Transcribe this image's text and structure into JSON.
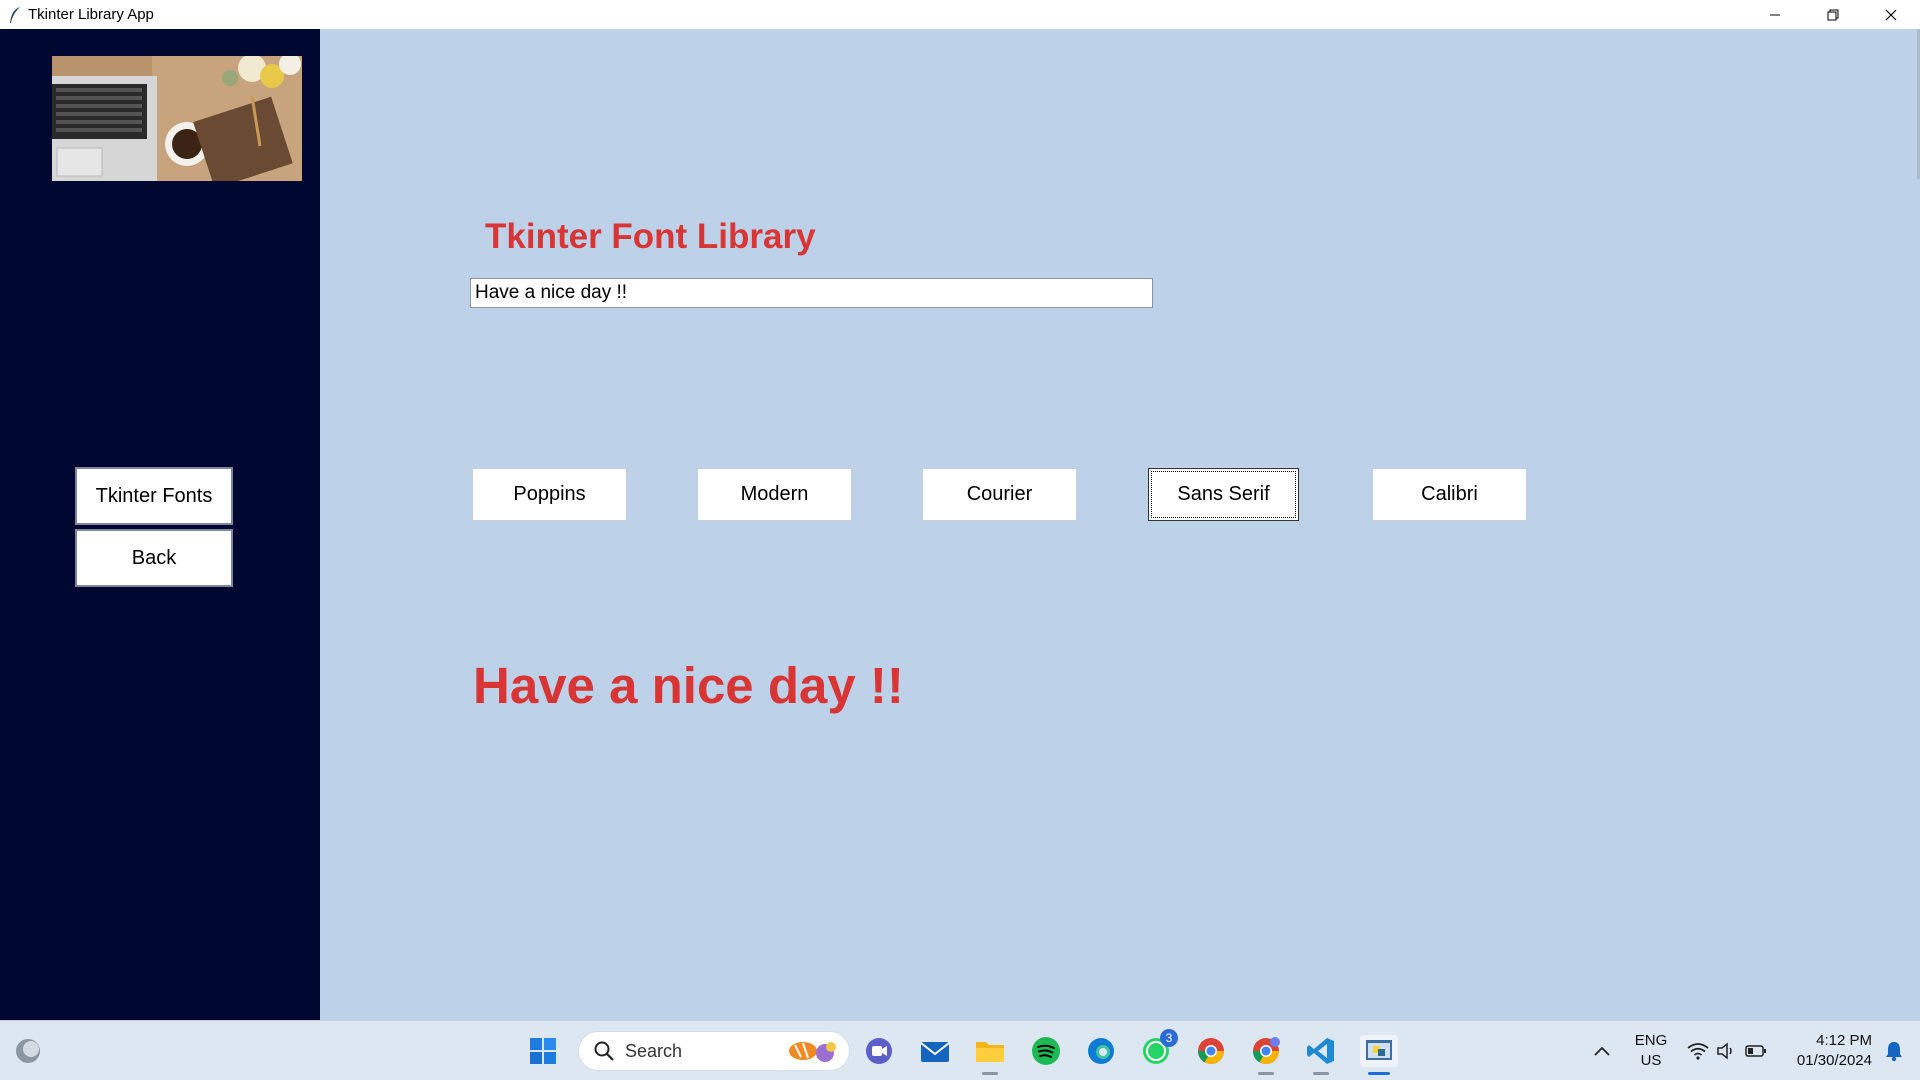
{
  "window": {
    "title": "Tkinter Library App"
  },
  "sidebar": {
    "buttons": [
      {
        "label": "Tkinter Fonts"
      },
      {
        "label": "Back"
      }
    ]
  },
  "main": {
    "title": "Tkinter Font Library",
    "entry_value": "Have a nice day !!",
    "font_buttons": [
      {
        "label": "Poppins"
      },
      {
        "label": "Modern"
      },
      {
        "label": "Courier"
      },
      {
        "label": "Sans Serif",
        "focused": true
      },
      {
        "label": "Calibri"
      }
    ],
    "preview_text": "Have a nice day !!"
  },
  "taskbar": {
    "search_label": "Search",
    "whatsapp_badge": "3",
    "language": {
      "line1": "ENG",
      "line2": "US"
    },
    "clock": {
      "time": "4:12 PM",
      "date": "01/30/2024"
    }
  },
  "colors": {
    "accent_red": "#d93535",
    "sidebar_bg": "#000731",
    "main_bg": "#bdd1e8"
  }
}
